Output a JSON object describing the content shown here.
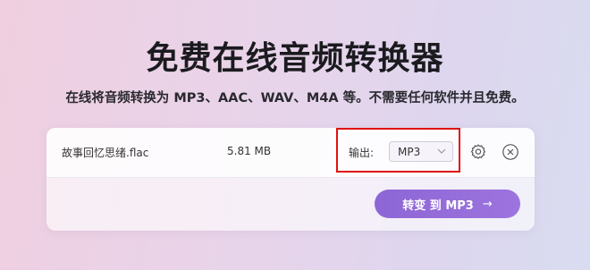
{
  "hero": {
    "title": "免费在线音频转换器",
    "subtitle": "在线将音频转换为 MP3、AAC、WAV、M4A 等。不需要任何软件并且免费。"
  },
  "file": {
    "name": "故事回忆思绪.flac",
    "size": "5.81 MB",
    "output_label": "输出:",
    "format_selected": "MP3"
  },
  "icons": {
    "format_dropdown": "chevron-down-icon",
    "settings": "gear-icon",
    "remove": "close-circle-icon",
    "convert_arrow": "arrow-right-icon"
  },
  "actions": {
    "convert_label": "转变 到 MP3",
    "convert_arrow": "→"
  },
  "colors": {
    "accent": "#9370DB",
    "highlight_box": "#E01010"
  }
}
